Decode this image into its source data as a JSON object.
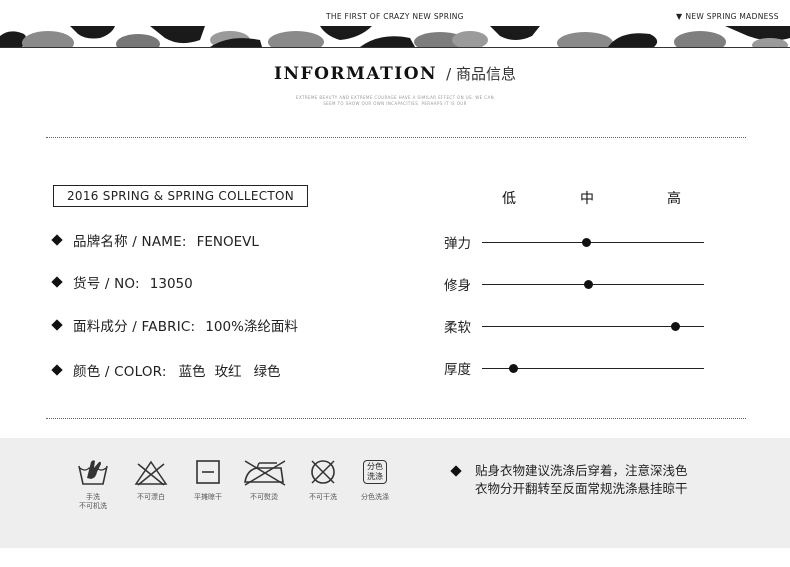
{
  "header": {
    "tagline": "THE FIRST OF CRAZY NEW SPRING",
    "right_text": "NEW SPRING MADNESS"
  },
  "section_title": {
    "en": "INFORMATION",
    "zh": "/ 商品信息",
    "fine_line_1": "EXTREME BEAUTY AND EXTREME COURAGE HAVE A SIMILAR EFFECT ON US. WE CAN",
    "fine_line_2": "SEEM TO SHOW OUR OWN INCAPACITIES. PERHAPS IT IS OUR"
  },
  "collection": "2016 SPRING & SPRING COLLECTON",
  "specs": [
    {
      "label": "品牌名称 / NAME:",
      "value": "FENOEVL"
    },
    {
      "label": "货号 / NO:",
      "value": "13050"
    },
    {
      "label": "面料成分 / FABRIC:",
      "value": "100%涤纶面料"
    },
    {
      "label": "颜色 / COLOR:",
      "values": [
        "蓝色",
        "玫红",
        "绿色"
      ]
    }
  ],
  "scale_labels": [
    "低",
    "中",
    "高"
  ],
  "ratings": [
    {
      "label": "弹力",
      "level": 0.47
    },
    {
      "label": "修身",
      "level": 0.48
    },
    {
      "label": "柔软",
      "level": 0.87
    },
    {
      "label": "厚度",
      "level": 0.14
    }
  ],
  "care": [
    {
      "icon": "hand-wash-icon",
      "caption_1": "手洗",
      "caption_2": "不可机洗"
    },
    {
      "icon": "no-bleach-icon",
      "caption_1": "不可漂白",
      "caption_2": ""
    },
    {
      "icon": "flat-dry-icon",
      "caption_1": "平摊晾干",
      "caption_2": ""
    },
    {
      "icon": "no-iron-icon",
      "caption_1": "不可熨烫",
      "caption_2": ""
    },
    {
      "icon": "no-dry-clean-icon",
      "caption_1": "不可干洗",
      "caption_2": ""
    },
    {
      "icon": "separate-wash-icon",
      "caption_1": "分色洗涤",
      "caption_2": "",
      "badge_1": "分色",
      "badge_2": "洗涤"
    }
  ],
  "care_note": {
    "line_1": "贴身衣物建议洗涤后穿着，注意深浅色",
    "line_2": "衣物分开翻转至反面常规洗涤悬挂晾干"
  }
}
